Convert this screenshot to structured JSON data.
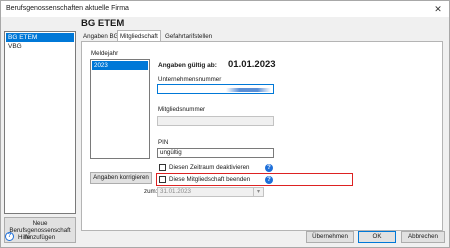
{
  "window": {
    "title": "Berufsgenossenschaften aktuelle Firma",
    "close_glyph": "✕"
  },
  "sidebar": {
    "items": [
      {
        "label": "BG ETEM",
        "selected": true
      },
      {
        "label": "VBG",
        "selected": false
      }
    ],
    "new_button": {
      "line1": "Neue",
      "line2": "Berufsgenossenschaft",
      "line3": "hinzufügen"
    }
  },
  "header": {
    "title": "BG ETEM"
  },
  "tabs": [
    {
      "label": "Angaben BG",
      "active": false
    },
    {
      "label": "Mitgliedschaft",
      "active": true
    },
    {
      "label": "Gefahrtarifstellen",
      "active": false
    }
  ],
  "membership": {
    "year_list_label": "Meldejahr",
    "years": [
      "2023"
    ],
    "valid_from_label": "Angaben gültig ab:",
    "valid_from_value": "01.01.2023",
    "company_number_label": "Unternehmensnummer",
    "company_number_value": "",
    "member_number_label": "Mitgliedsnummer",
    "member_number_value": "",
    "pin_label": "PIN",
    "pin_value": "ungültig",
    "correct_button": "Angaben korrigieren",
    "deactivate_label": "Diesen Zeitraum deaktivieren",
    "end_membership_label": "Diese Mitgliedschaft beenden",
    "end_date_label": "zum:",
    "end_date_value": "31.01.2023",
    "help_glyph": "?",
    "dropdown_glyph": "▾"
  },
  "footer": {
    "help_label": "Hilfe",
    "help_glyph": "?",
    "apply_button": "Übernehmen",
    "ok_button": "OK",
    "cancel_button": "Abbrechen"
  },
  "colors": {
    "accent": "#0078d7",
    "highlight_border": "#d22222",
    "help_icon": "#1e6fd9"
  }
}
